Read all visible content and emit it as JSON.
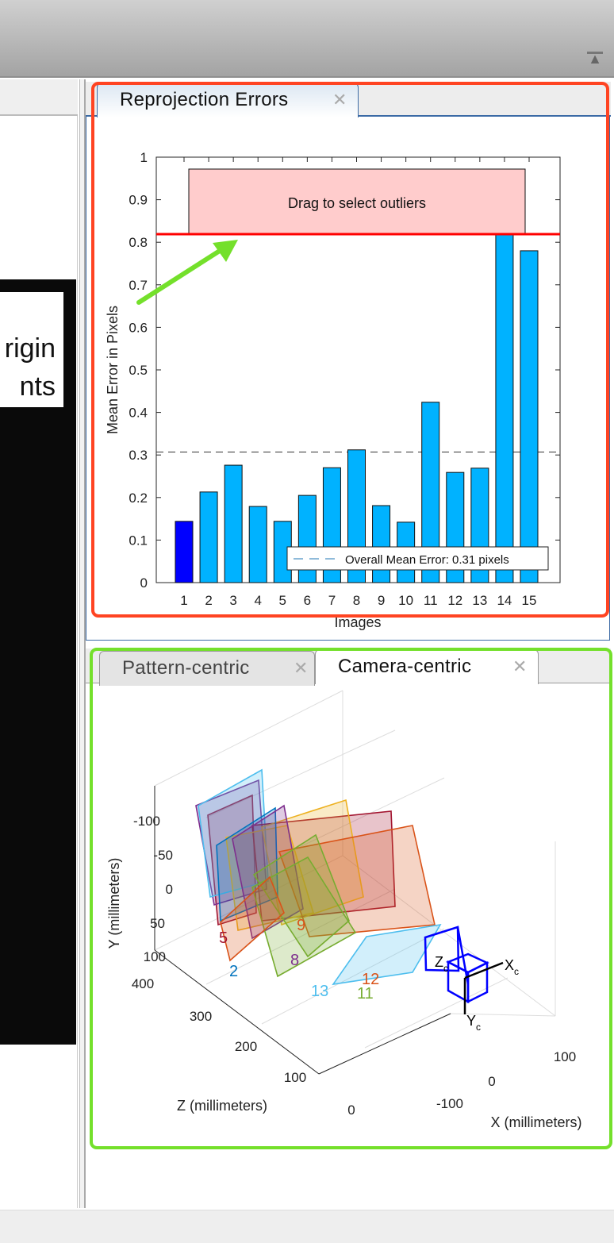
{
  "toolbar": {
    "collapse_icon": "collapse-up-icon"
  },
  "left_panel": {
    "image_text_line1": "rigin",
    "image_text_line2": "nts"
  },
  "reprojection_panel": {
    "tab_label": "Reprojection Errors",
    "close_icon": "close-icon",
    "outlier_box_label": "Drag to select outliers",
    "legend_label": "Overall Mean Error: 0.31 pixels"
  },
  "chart_data": {
    "type": "bar",
    "title": "",
    "xlabel": "Images",
    "ylabel": "Mean Error in Pixels",
    "categories": [
      "1",
      "2",
      "3",
      "4",
      "5",
      "6",
      "7",
      "8",
      "9",
      "10",
      "11",
      "12",
      "13",
      "14",
      "15"
    ],
    "values": [
      0.144,
      0.213,
      0.276,
      0.179,
      0.144,
      0.205,
      0.27,
      0.312,
      0.181,
      0.142,
      0.424,
      0.259,
      0.269,
      0.83,
      0.78
    ],
    "ylim": [
      0,
      1
    ],
    "yticks": [
      "0",
      "0.1",
      "0.2",
      "0.3",
      "0.4",
      "0.5",
      "0.6",
      "0.7",
      "0.8",
      "0.9",
      "1"
    ],
    "overall_mean": 0.307,
    "outlier_threshold": 0.819,
    "selected_bar": "1",
    "colors": {
      "bar": "#00b2ff",
      "selected_bar": "#0000ff",
      "threshold": "#ff0000",
      "outlier_box": "#ffcccc",
      "mean_line": "#1f77b4"
    },
    "legend_placement": "bottom-right",
    "grid": false
  },
  "extrinsics_panel": {
    "tabs": [
      {
        "label": "Pattern-centric",
        "active": false
      },
      {
        "label": "Camera-centric",
        "active": true
      }
    ],
    "y_label": "Y (millimeters)",
    "z_label": "Z (millimeters)",
    "x_label": "X (millimeters)",
    "y_ticks": [
      "-100",
      "-50",
      "0",
      "50",
      "100"
    ],
    "z_ticks": [
      "400",
      "300",
      "200",
      "100",
      "0"
    ],
    "x_ticks": [
      "-100",
      "0",
      "100"
    ],
    "camera_axes": {
      "x": "X",
      "y": "Y",
      "z": "Z",
      "sub": "c"
    },
    "board_labels": [
      "5",
      "2",
      "8",
      "9",
      "13",
      "11",
      "12"
    ]
  },
  "annotations": {
    "red_highlight": "#ff4422",
    "green_highlight": "#74e02b",
    "arrow": "#74e02b"
  }
}
